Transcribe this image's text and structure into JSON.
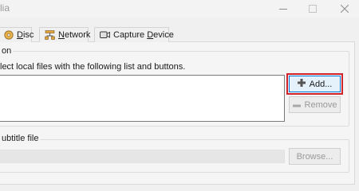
{
  "window": {
    "title": "lia"
  },
  "tabs": [
    {
      "label": "Disc",
      "icon": "disc-icon",
      "underline_index": 0
    },
    {
      "label": "Network",
      "icon": "network-icon",
      "underline_index": 0
    },
    {
      "label": "Capture Device",
      "icon": "capture-device-icon",
      "underline_index": 8
    }
  ],
  "file_selection": {
    "group_label": "on",
    "instructions": "lect local files with the following list and buttons.",
    "files": [],
    "add_button": "Add...",
    "remove_button": "Remove"
  },
  "subtitle": {
    "group_label": "ubtitle file",
    "path_value": "",
    "browse_button": "Browse..."
  },
  "colors": {
    "highlight_border": "#d2232a",
    "focus_border": "#0078d7"
  }
}
